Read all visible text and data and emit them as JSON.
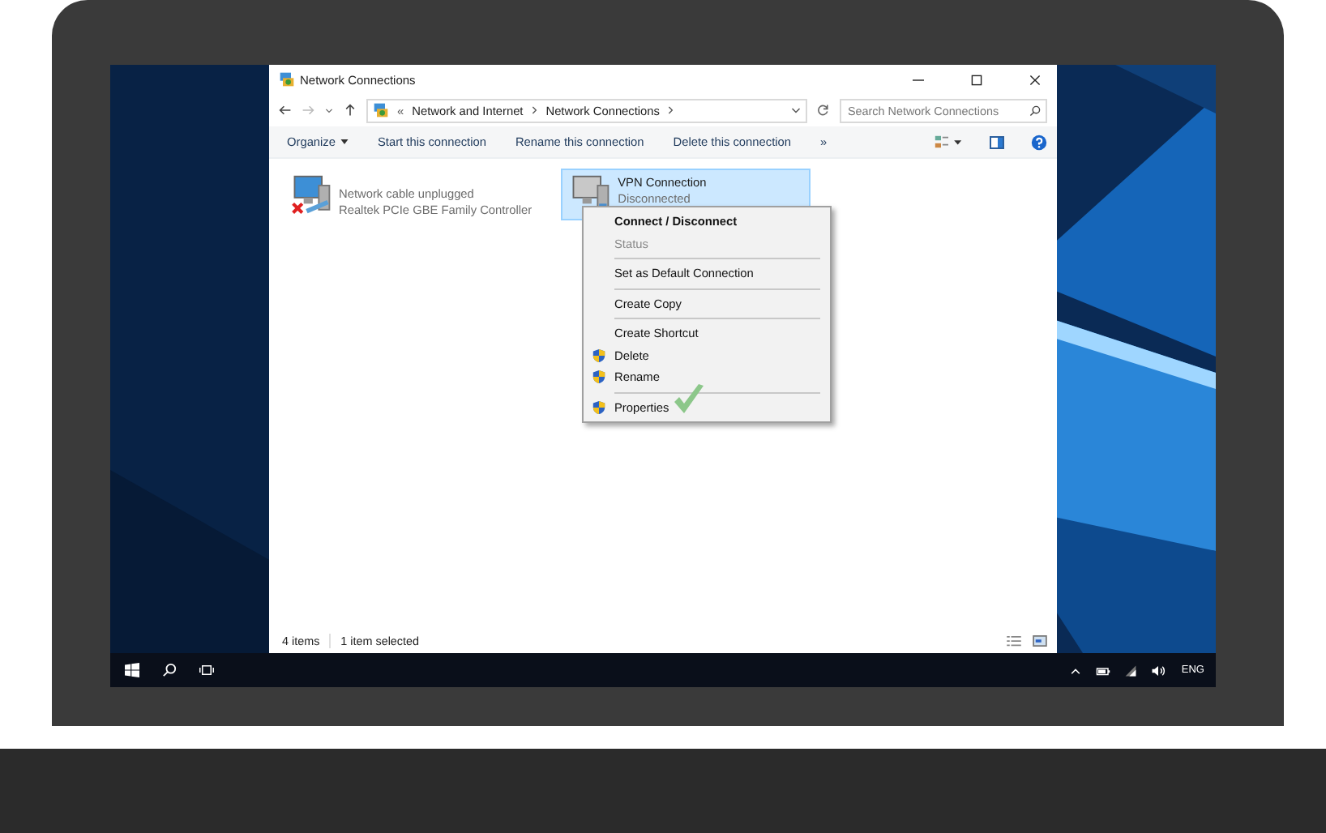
{
  "window": {
    "title": "Network Connections"
  },
  "address_bar": {
    "overflow": "«",
    "path": [
      "Network and Internet",
      "Network Connections"
    ]
  },
  "search": {
    "placeholder": "Search Network Connections"
  },
  "toolbar": [
    {
      "label": "Organize",
      "kind": "dropdown"
    },
    {
      "label": "Start this connection",
      "kind": "command"
    },
    {
      "label": "Rename this connection",
      "kind": "command"
    },
    {
      "label": "Delete this connection",
      "kind": "command"
    },
    {
      "label": "»",
      "kind": "more"
    }
  ],
  "connections": [
    {
      "status": "Network cable unplugged",
      "device": "Realtek PCIe GBE Family Controller",
      "unplugged": true,
      "selected": false
    },
    {
      "name": "VPN Connection",
      "status": "Disconnected",
      "unplugged": false,
      "selected": true
    }
  ],
  "context_menu": [
    {
      "kind": "item",
      "label": "Connect / Disconnect",
      "default": true,
      "disabled": false,
      "shield": false
    },
    {
      "kind": "item",
      "label": "Status",
      "default": false,
      "disabled": true,
      "shield": false
    },
    {
      "kind": "separator"
    },
    {
      "kind": "item",
      "label": "Set as Default Connection",
      "default": false,
      "disabled": false,
      "shield": false
    },
    {
      "kind": "separator"
    },
    {
      "kind": "item",
      "label": "Create Copy",
      "default": false,
      "disabled": false,
      "shield": false
    },
    {
      "kind": "separator"
    },
    {
      "kind": "item",
      "label": "Create Shortcut",
      "default": false,
      "disabled": false,
      "shield": false
    },
    {
      "kind": "item",
      "label": "Delete",
      "default": false,
      "disabled": false,
      "shield": true
    },
    {
      "kind": "item",
      "label": "Rename",
      "default": false,
      "disabled": false,
      "shield": true
    },
    {
      "kind": "separator"
    },
    {
      "kind": "item",
      "label": "Properties",
      "default": false,
      "disabled": false,
      "shield": true
    }
  ],
  "status_bar": {
    "count": "4 items",
    "selection": "1 item selected"
  },
  "taskbar": {
    "language": "ENG"
  }
}
